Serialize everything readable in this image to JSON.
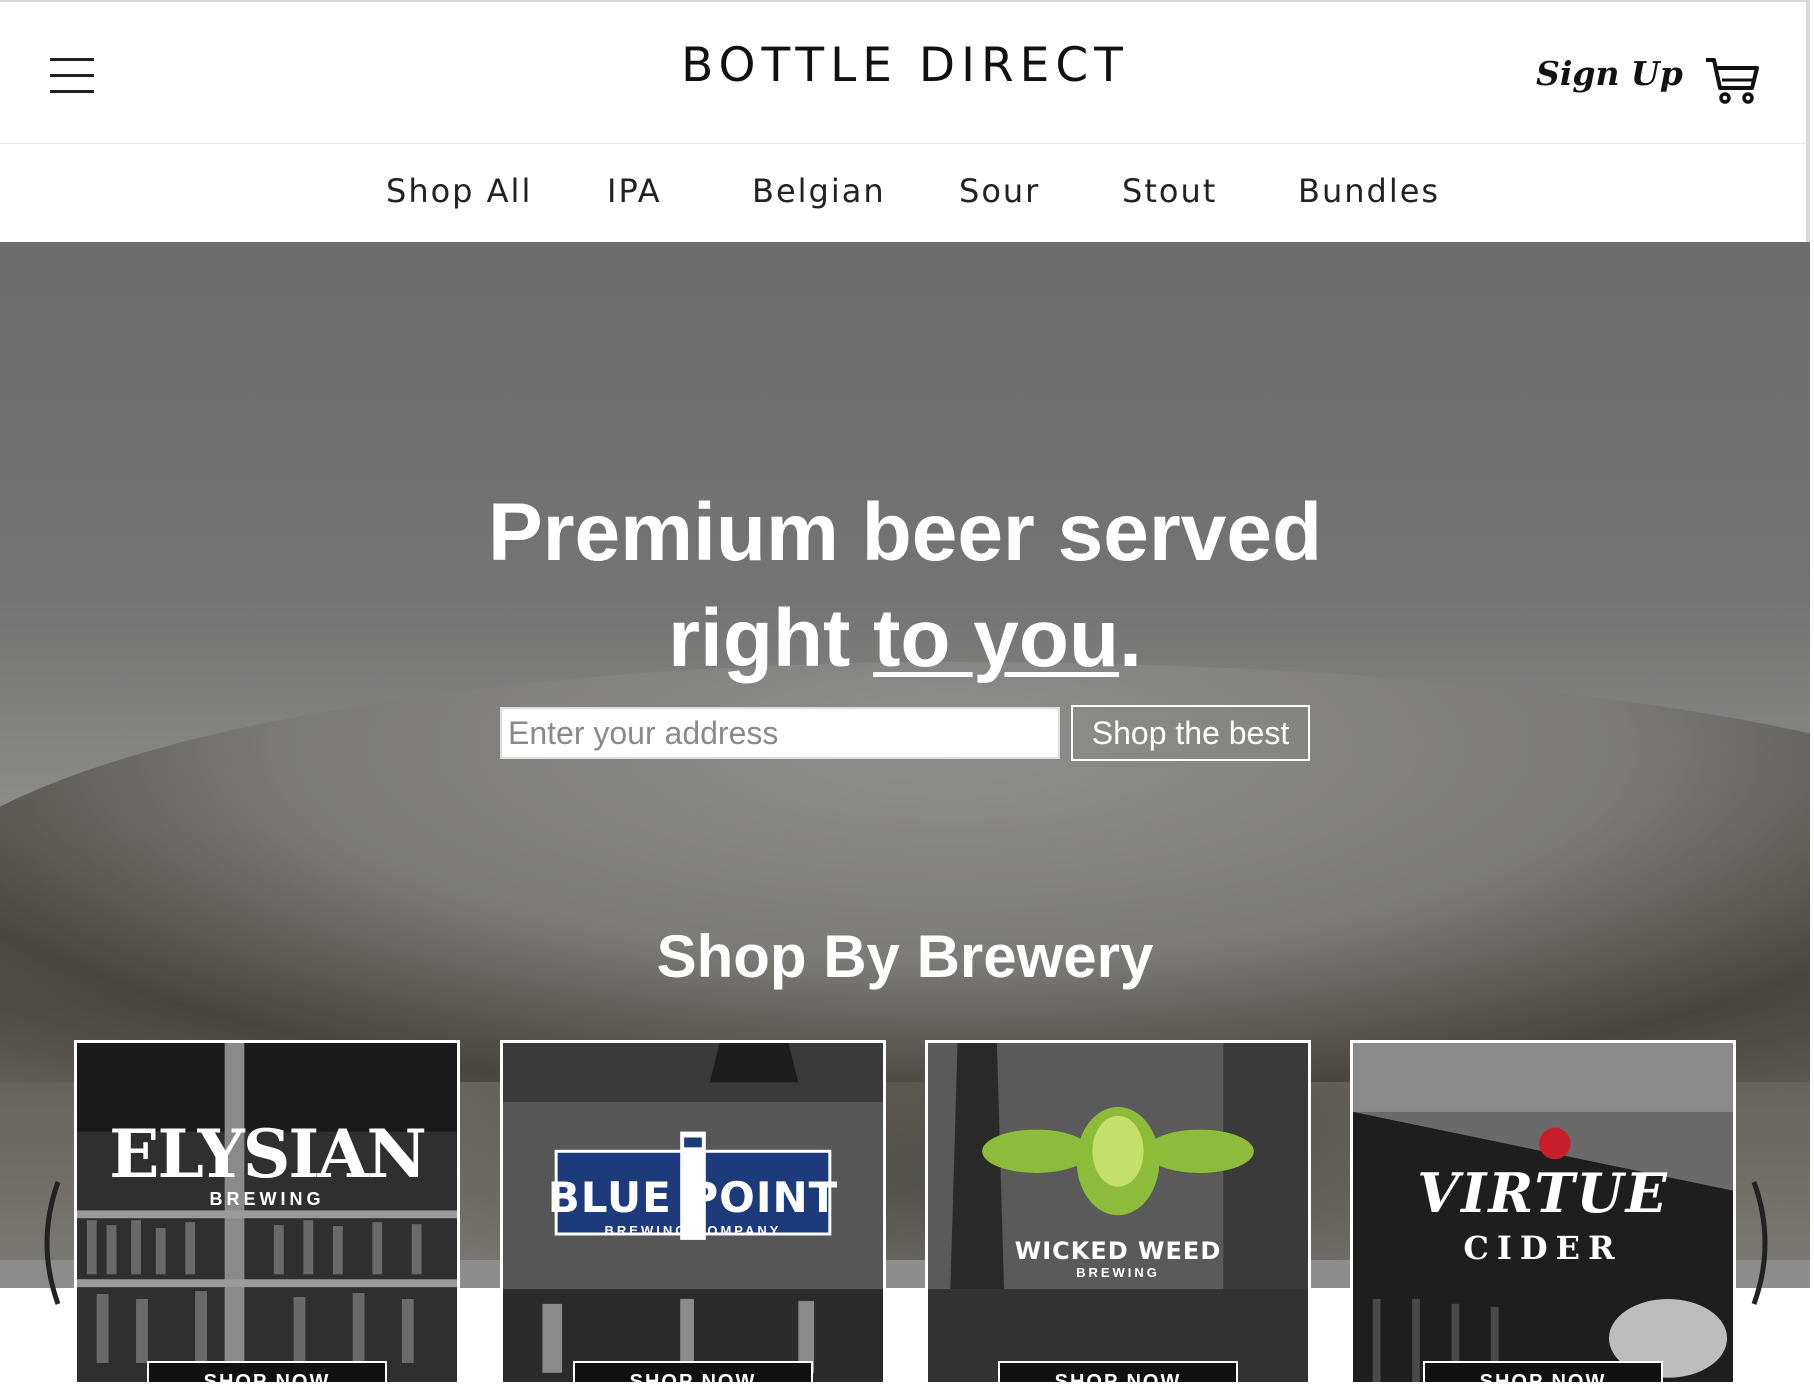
{
  "header": {
    "logo": "BOTTLE DIRECT",
    "signup_label": "Sign Up",
    "menu_icon": "hamburger-menu-icon",
    "cart_icon": "shopping-cart-icon"
  },
  "nav": {
    "items": [
      {
        "label": "Shop All"
      },
      {
        "label": "IPA"
      },
      {
        "label": "Belgian"
      },
      {
        "label": "Sour"
      },
      {
        "label": "Stout"
      },
      {
        "label": "Bundles"
      }
    ]
  },
  "hero": {
    "headline_line1": "Premium beer served",
    "headline_line2_start": "right ",
    "headline_line2_underlined": "to you",
    "headline_line2_end": ".",
    "address_placeholder": "Enter your address",
    "submit_label": "Shop the best"
  },
  "breweries": {
    "title": "Shop By Brewery",
    "items": [
      {
        "name": "ELYSIAN",
        "subtitle": "BREWING",
        "button": "SHOP NOW"
      },
      {
        "name": "BLUE POINT",
        "subtitle": "BREWING COMPANY",
        "button": "SHOP NOW"
      },
      {
        "name": "WICKED WEED",
        "subtitle": "BREWING",
        "button": "SHOP NOW"
      },
      {
        "name": "VIRTUE",
        "subtitle": "CIDER",
        "button": "SHOP NOW"
      }
    ],
    "prev_icon": "chevron-left-icon",
    "next_icon": "chevron-right-icon"
  },
  "colors": {
    "text": "#111111",
    "hero_overlay": "#6e6e6e",
    "bluepoint_blue": "#1d3a7a",
    "wickedweed_green": "#8dbb3a",
    "virtue_red": "#c8202a"
  }
}
